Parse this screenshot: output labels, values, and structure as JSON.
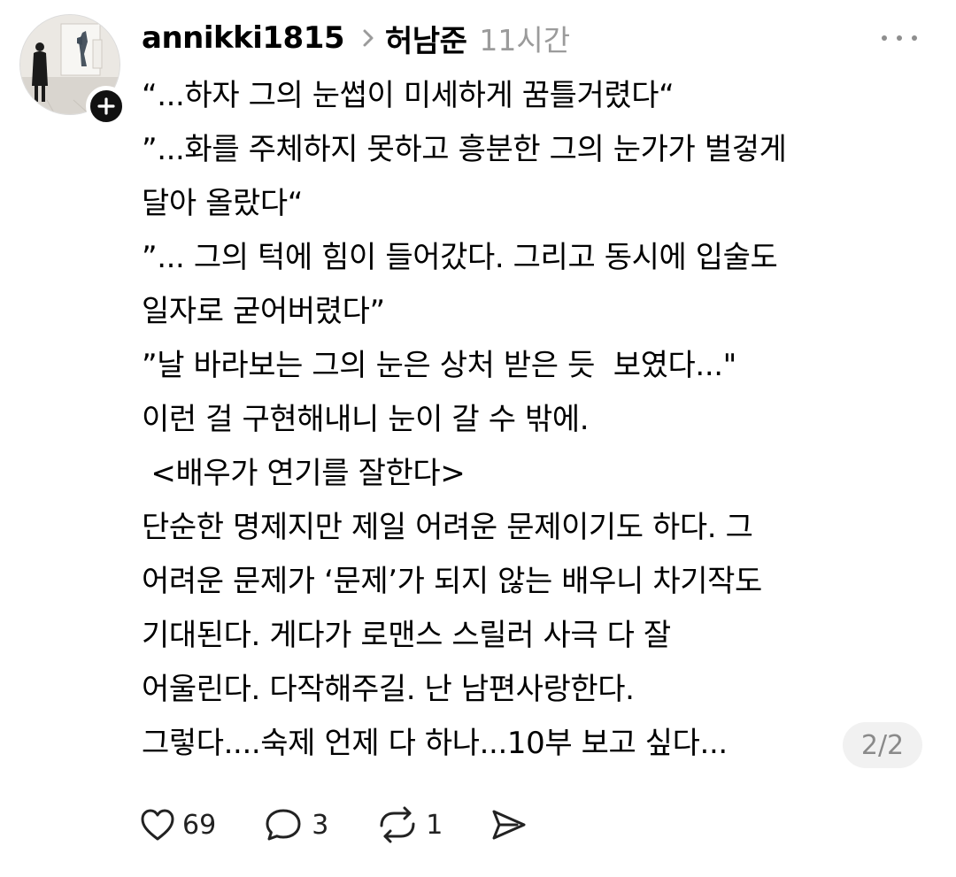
{
  "post": {
    "username": "annikki1815",
    "topic": "허남준",
    "timestamp": "11시간",
    "lines": [
      "“...하자 그의 눈썹이 미세하게 꿈틀거렸다“",
      "”...화를 주체하지 못하고 흥분한 그의 눈가가 벌겋게",
      "달아 올랐다“",
      "”... 그의 턱에 힘이 들어갔다. 그리고 동시에 입술도",
      "일자로 굳어버렸다”",
      "”날 바라보는 그의 눈은 상처 받은 듯  보였다...\"",
      "이런 걸 구현해내니 눈이 갈 수 밖에.",
      " <배우가 연기를 잘한다>",
      "단순한 명제지만 제일 어려운 문제이기도 하다. 그",
      "어려운 문제가 ‘문제’가 되지 않는 배우니 차기작도",
      "기대된다. 게다가 로맨스 스릴러 사극 다 잘",
      "어울린다. 다작해주길. 난 남편사랑한다.",
      "그렇다....숙제 언제 다 하나...10부 보고 싶다..."
    ],
    "page_indicator": "2/2"
  },
  "actions": {
    "likes": "69",
    "replies": "3",
    "reposts": "1"
  },
  "icons": {
    "follow": "plus-icon",
    "more": "more-dots-icon",
    "like": "heart-icon",
    "reply": "speech-bubble-icon",
    "repost": "repost-icon",
    "share": "send-icon",
    "breadcrumb": "chevron-right-icon"
  },
  "colors": {
    "text": "#000000",
    "muted": "#9b9b9b",
    "badge_bg": "#111111",
    "pill_bg": "#f1f1f1"
  }
}
